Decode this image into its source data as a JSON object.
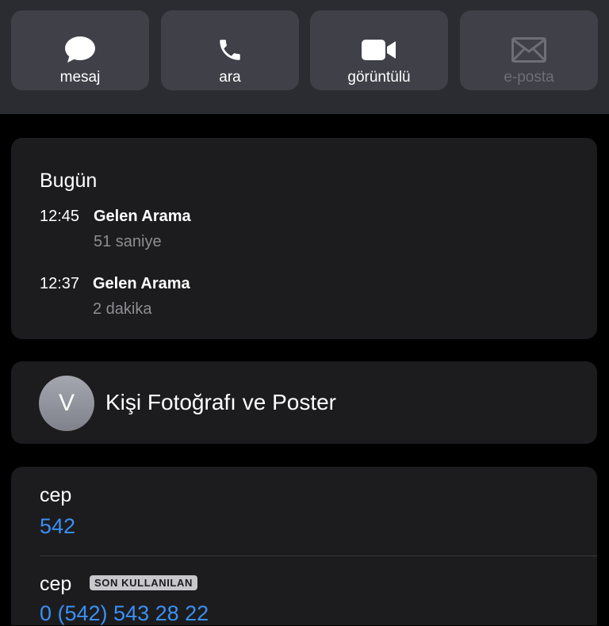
{
  "actions": [
    {
      "label": "mesaj",
      "icon": "message-bubble-icon",
      "enabled": true
    },
    {
      "label": "ara",
      "icon": "phone-icon",
      "enabled": true
    },
    {
      "label": "görüntülü",
      "icon": "video-camera-icon",
      "enabled": true
    },
    {
      "label": "e-posta",
      "icon": "envelope-icon",
      "enabled": false
    }
  ],
  "history": {
    "day": "Bugün",
    "calls": [
      {
        "time": "12:45",
        "type": "Gelen Arama",
        "duration": "51 saniye"
      },
      {
        "time": "12:37",
        "type": "Gelen Arama",
        "duration": "2 dakika"
      }
    ]
  },
  "contact_photo": {
    "initial": "V",
    "label": "Kişi Fotoğrafı ve Poster"
  },
  "phones": [
    {
      "label": "cep",
      "number": "542",
      "badge": ""
    },
    {
      "label": "cep",
      "number": "0 (542) 543 28 22",
      "badge": "SON KULLANILAN"
    }
  ],
  "colors": {
    "accent": "#3a8ff5",
    "button_bg": "#3f4048",
    "card_bg": "#1c1c1e",
    "secondary_text": "#8d8d93"
  }
}
